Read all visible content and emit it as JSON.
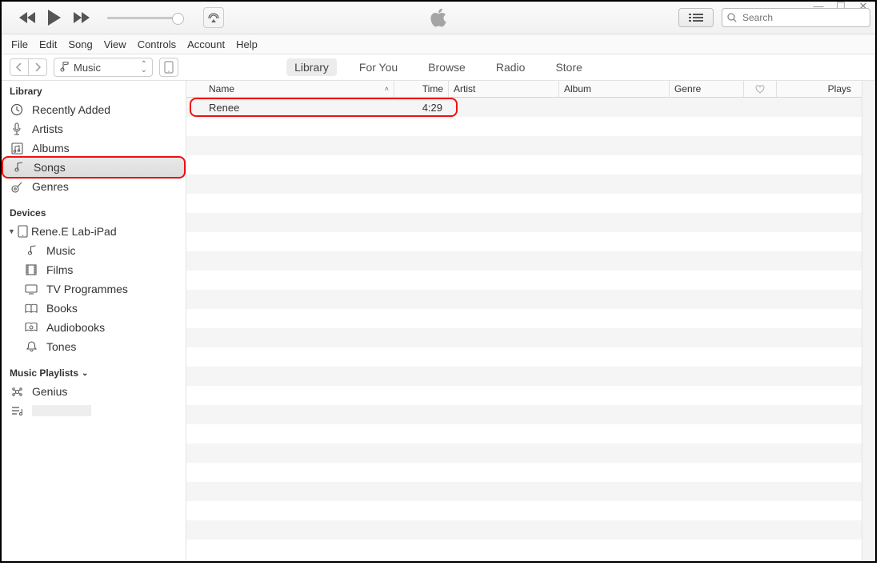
{
  "window_controls": {
    "min": "—",
    "max": "☐",
    "close": "✕"
  },
  "search": {
    "placeholder": "Search"
  },
  "menubar": [
    "File",
    "Edit",
    "Song",
    "View",
    "Controls",
    "Account",
    "Help"
  ],
  "media_picker": {
    "label": "Music"
  },
  "tabs": [
    "Library",
    "For You",
    "Browse",
    "Radio",
    "Store"
  ],
  "active_tab": "Library",
  "sidebar": {
    "library_header": "Library",
    "library": [
      {
        "label": "Recently Added",
        "key": "recent"
      },
      {
        "label": "Artists",
        "key": "artists"
      },
      {
        "label": "Albums",
        "key": "albums"
      },
      {
        "label": "Songs",
        "key": "songs",
        "selected": true,
        "highlight": true
      },
      {
        "label": "Genres",
        "key": "genres"
      }
    ],
    "devices_header": "Devices",
    "device": {
      "name": "Rene.E Lab-iPad"
    },
    "device_items": [
      {
        "label": "Music",
        "key": "dev-music"
      },
      {
        "label": "Films",
        "key": "dev-films"
      },
      {
        "label": "TV Programmes",
        "key": "dev-tv"
      },
      {
        "label": "Books",
        "key": "dev-books"
      },
      {
        "label": "Audiobooks",
        "key": "dev-audiobooks"
      },
      {
        "label": "Tones",
        "key": "dev-tones"
      }
    ],
    "playlists_header": "Music Playlists",
    "playlists": [
      {
        "label": "Genius",
        "key": "genius"
      }
    ]
  },
  "columns": {
    "name": "Name",
    "time": "Time",
    "artist": "Artist",
    "album": "Album",
    "genre": "Genre",
    "plays": "Plays"
  },
  "songs": [
    {
      "name": "Renee",
      "time": "4:29",
      "artist": "",
      "album": "",
      "genre": "",
      "plays": ""
    }
  ]
}
